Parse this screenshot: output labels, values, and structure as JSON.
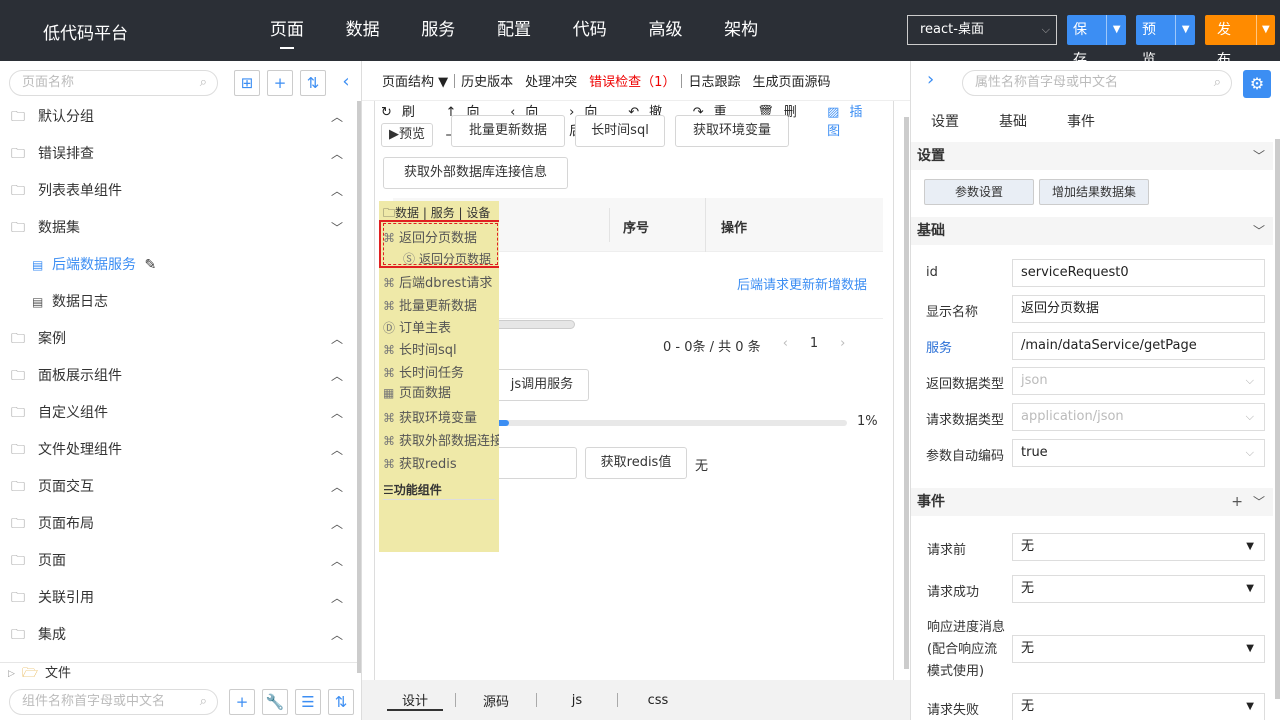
{
  "app": {
    "brand": "低代码平台",
    "nav": [
      "页面",
      "数据",
      "服务",
      "配置",
      "代码",
      "高级",
      "架构"
    ],
    "env_select": "react-桌面",
    "save_label": "保存",
    "preview_label": "预览",
    "publish_label": "发布"
  },
  "left": {
    "search_placeholder": "页面名称",
    "tree": [
      {
        "label": "默认分组",
        "expanded": false
      },
      {
        "label": "错误排查",
        "expanded": false
      },
      {
        "label": "列表表单组件",
        "expanded": false
      },
      {
        "label": "数据集",
        "expanded": true
      },
      {
        "label": "后端数据服务",
        "sub": true,
        "active": true
      },
      {
        "label": "数据日志",
        "sub": true
      },
      {
        "label": "案例",
        "expanded": false
      },
      {
        "label": "面板展示组件",
        "expanded": false
      },
      {
        "label": "自定义组件",
        "expanded": false
      },
      {
        "label": "文件处理组件",
        "expanded": false
      },
      {
        "label": "页面交互",
        "expanded": false
      },
      {
        "label": "页面布局",
        "expanded": false
      },
      {
        "label": "页面",
        "expanded": false
      },
      {
        "label": "关联引用",
        "expanded": false
      },
      {
        "label": "集成",
        "expanded": false
      }
    ],
    "file_label": "文件",
    "component_search_placeholder": "组件名称首字母或中文名"
  },
  "center": {
    "toolbar": [
      "页面结构 ▼",
      "历史版本",
      "处理冲突",
      "错误检查（1）",
      "日志跟踪",
      "生成页面源码"
    ],
    "actions": [
      "刷新",
      "向上",
      "向前",
      "向后",
      "撤销",
      "重做",
      "删除",
      "插图"
    ],
    "buttons": {
      "preview": "预览",
      "batch_update": "批量更新数据",
      "long_sql": "长时间sql",
      "get_env": "获取环境变量",
      "get_ext_db": "获取外部数据库连接信息",
      "js_call": "js调用服务",
      "get_redis": "获取redis值"
    },
    "grid": {
      "col_seq": "序号",
      "col_op": "操作",
      "link": "后端请求更新新增数据"
    },
    "pager": {
      "summary": "0 - 0条 / 共 0 条",
      "prev": "‹",
      "page": "1",
      "next": "›"
    },
    "progress": {
      "value": 0.01,
      "label": "1%"
    },
    "redis_value": "无",
    "popup": {
      "header": "数据 | 服务 | 设备",
      "items": [
        "返回分页数据",
        "返回分页数据",
        "后端dbrest请求",
        "批量更新数据",
        "订单主表",
        "长时间sql",
        "长时间任务",
        "页面数据",
        "获取环境变量",
        "获取外部数据连接",
        "获取redis"
      ],
      "footer": "功能组件"
    },
    "bottom_tabs": [
      "设计",
      "源码",
      "js",
      "css"
    ]
  },
  "right": {
    "search_placeholder": "属性名称首字母或中文名",
    "tabs": [
      "设置",
      "基础",
      "事件"
    ],
    "sections": {
      "settings": "设置",
      "basic": "基础",
      "events": "事件"
    },
    "settings_buttons": [
      "参数设置",
      "增加结果数据集"
    ],
    "props": {
      "id": {
        "label": "id",
        "value": "serviceRequest0"
      },
      "display_name": {
        "label": "显示名称",
        "value": "返回分页数据"
      },
      "service": {
        "label": "服务",
        "value": "/main/dataService/getPage"
      },
      "return_type": {
        "label": "返回数据类型",
        "value": "json"
      },
      "request_type": {
        "label": "请求数据类型",
        "value": "application/json"
      },
      "auto_encode": {
        "label": "参数自动编码",
        "value": "true"
      }
    },
    "events": {
      "before": {
        "label": "请求前",
        "value": "无"
      },
      "success": {
        "label": "请求成功",
        "value": "无"
      },
      "progress": {
        "label_lines": [
          "响应进度消息",
          "(配合响应流",
          "模式使用)"
        ],
        "value": "无"
      },
      "fail": {
        "label": "请求失败",
        "value": "无"
      }
    }
  }
}
